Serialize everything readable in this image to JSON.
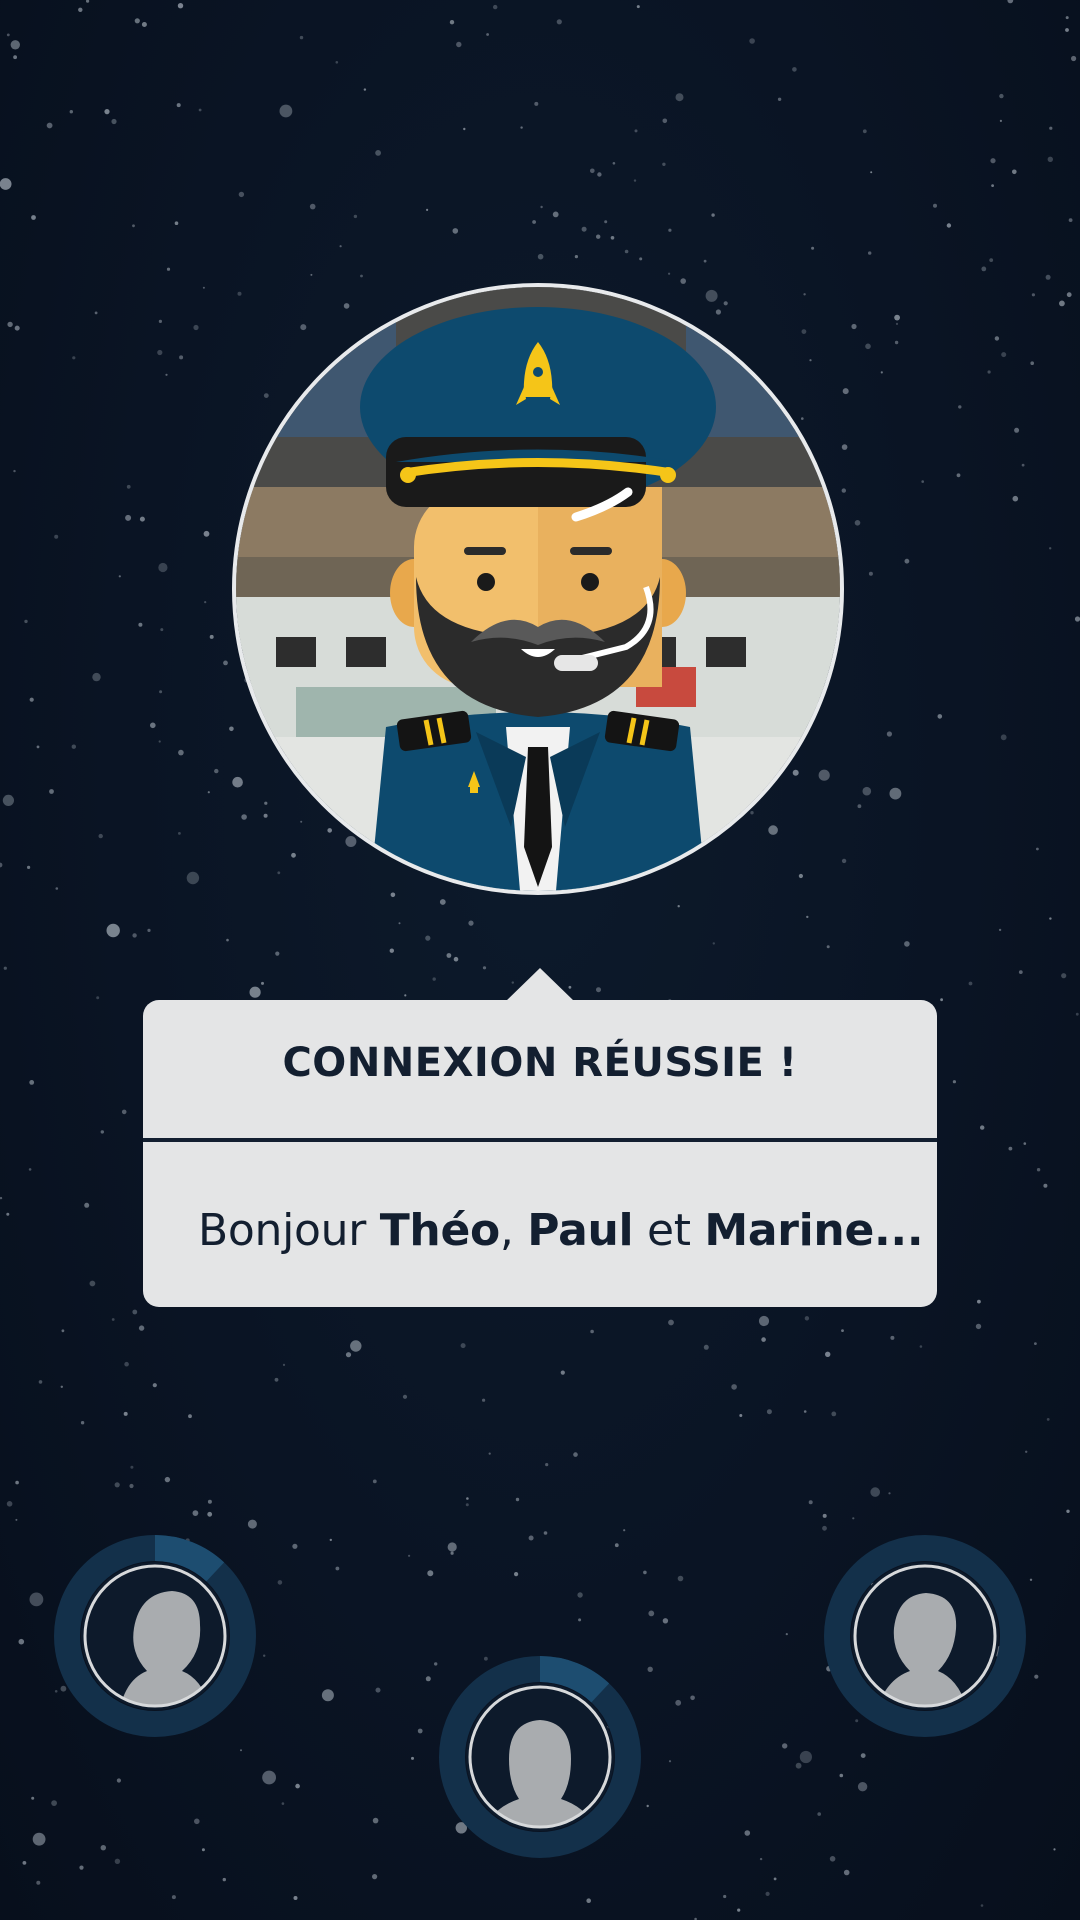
{
  "dialog": {
    "title": "CONNEXION RÉUSSIE !",
    "greeting": "Bonjour",
    "name1": "Théo",
    "sep1": ",",
    "name2": "Paul",
    "conj": "et",
    "name3": "Marine...",
    "character_icon": "pilot-captain-avatar"
  },
  "players": [
    {
      "slot": "left",
      "icon": "player-silhouette-icon",
      "progress": 0.12
    },
    {
      "slot": "center",
      "icon": "player-silhouette-icon",
      "progress": 0.12
    },
    {
      "slot": "right",
      "icon": "player-silhouette-icon",
      "progress": 0.0
    }
  ],
  "colors": {
    "background": "#0a1424",
    "bubble": "#e4e5e6",
    "text_dark": "#131f30",
    "ring_track": "#13304a",
    "ring_progress": "#1d4d70",
    "silhouette": "#a9acaf",
    "cap_blue": "#0d4a6e",
    "gold": "#f5c518"
  }
}
